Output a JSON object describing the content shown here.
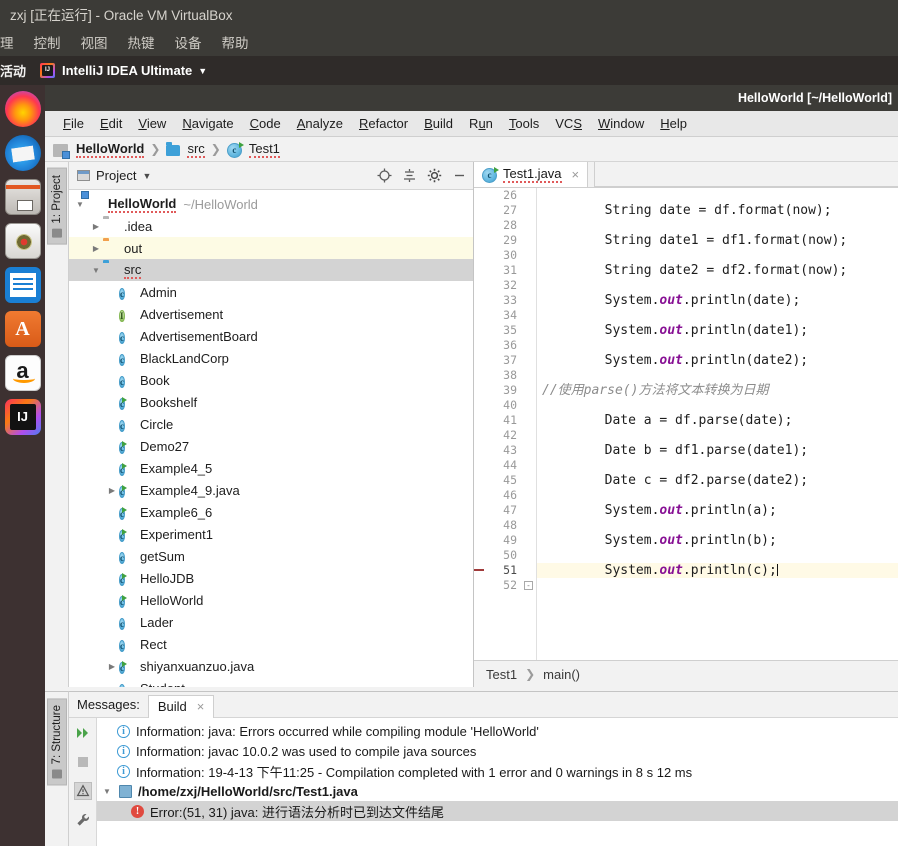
{
  "host": {
    "vbox_title": "zxj [正在运行] - Oracle VM VirtualBox",
    "vbox_menus": [
      "理",
      "控制",
      "视图",
      "热键",
      "设备",
      "帮助"
    ],
    "ubuntu_activities": "活动",
    "ubuntu_app": "IntelliJ IDEA Ultimate",
    "panel_caret": "▼"
  },
  "dock": {
    "items": [
      {
        "name": "firefox-icon",
        "label": "Firefox"
      },
      {
        "name": "thunderbird-icon",
        "label": "Thunderbird Mail"
      },
      {
        "name": "files-icon",
        "label": "Files"
      },
      {
        "name": "rhythmbox-icon",
        "label": "Rhythmbox"
      },
      {
        "name": "libreoffice-writer-icon",
        "label": "LibreOffice Writer"
      },
      {
        "name": "ubuntu-software-icon",
        "label": "Ubuntu Software"
      },
      {
        "name": "amazon-icon",
        "label": "Amazon"
      },
      {
        "name": "intellij-idea-icon",
        "label": "IntelliJ IDEA"
      }
    ]
  },
  "ide": {
    "window_title": "HelloWorld [~/HelloWorld]",
    "menus": [
      {
        "label": "File",
        "mnemonic": "F"
      },
      {
        "label": "Edit",
        "mnemonic": "E"
      },
      {
        "label": "View",
        "mnemonic": "V"
      },
      {
        "label": "Navigate",
        "mnemonic": "N"
      },
      {
        "label": "Code",
        "mnemonic": "C"
      },
      {
        "label": "Analyze",
        "mnemonic": "A"
      },
      {
        "label": "Refactor",
        "mnemonic": "R"
      },
      {
        "label": "Build",
        "mnemonic": "B"
      },
      {
        "label": "Run",
        "mnemonic": "u"
      },
      {
        "label": "Tools",
        "mnemonic": "T"
      },
      {
        "label": "VCS",
        "mnemonic": "S"
      },
      {
        "label": "Window",
        "mnemonic": "W"
      },
      {
        "label": "Help",
        "mnemonic": "H"
      }
    ],
    "navbar": [
      "HelloWorld",
      "src",
      "Test1"
    ],
    "left_tool_tab": "1: Project",
    "bottom_tool_tab": "7: Structure"
  },
  "project": {
    "title": "Project",
    "toolbar": [
      "locate-icon",
      "collapse-all-icon",
      "settings-gear-icon",
      "hide-icon"
    ],
    "tree": [
      {
        "label": "HelloWorld",
        "path": "~/HelloWorld",
        "icon": "module",
        "indent": 0,
        "arrow": "open",
        "bold": true,
        "state": "normal",
        "squiggle": true
      },
      {
        "label": ".idea",
        "path": "",
        "icon": "folder-gray",
        "indent": 1,
        "arrow": "closed",
        "bold": false,
        "state": "normal",
        "squiggle": false
      },
      {
        "label": "out",
        "path": "",
        "icon": "folder-orange",
        "indent": 1,
        "arrow": "closed",
        "bold": false,
        "state": "highlight",
        "squiggle": false
      },
      {
        "label": "src",
        "path": "",
        "icon": "folder-blue",
        "indent": 1,
        "arrow": "open",
        "bold": false,
        "state": "selected",
        "squiggle": true
      },
      {
        "label": "Admin",
        "path": "",
        "icon": "class",
        "indent": 2,
        "arrow": "none",
        "bold": false,
        "state": "normal",
        "squiggle": false
      },
      {
        "label": "Advertisement",
        "path": "",
        "icon": "interface",
        "indent": 2,
        "arrow": "none",
        "bold": false,
        "state": "normal",
        "squiggle": false
      },
      {
        "label": "AdvertisementBoard",
        "path": "",
        "icon": "class",
        "indent": 2,
        "arrow": "none",
        "bold": false,
        "state": "normal",
        "squiggle": false
      },
      {
        "label": "BlackLandCorp",
        "path": "",
        "icon": "class",
        "indent": 2,
        "arrow": "none",
        "bold": false,
        "state": "normal",
        "squiggle": false
      },
      {
        "label": "Book",
        "path": "",
        "icon": "class",
        "indent": 2,
        "arrow": "none",
        "bold": false,
        "state": "normal",
        "squiggle": false
      },
      {
        "label": "Bookshelf",
        "path": "",
        "icon": "class-run",
        "indent": 2,
        "arrow": "none",
        "bold": false,
        "state": "normal",
        "squiggle": false
      },
      {
        "label": "Circle",
        "path": "",
        "icon": "class",
        "indent": 2,
        "arrow": "none",
        "bold": false,
        "state": "normal",
        "squiggle": false
      },
      {
        "label": "Demo27",
        "path": "",
        "icon": "class-run",
        "indent": 2,
        "arrow": "none",
        "bold": false,
        "state": "normal",
        "squiggle": false
      },
      {
        "label": "Example4_5",
        "path": "",
        "icon": "class-run",
        "indent": 2,
        "arrow": "none",
        "bold": false,
        "state": "normal",
        "squiggle": false
      },
      {
        "label": "Example4_9.java",
        "path": "",
        "icon": "class-run",
        "indent": 2,
        "arrow": "closed",
        "bold": false,
        "state": "normal",
        "squiggle": false
      },
      {
        "label": "Example6_6",
        "path": "",
        "icon": "class-run",
        "indent": 2,
        "arrow": "none",
        "bold": false,
        "state": "normal",
        "squiggle": false
      },
      {
        "label": "Experiment1",
        "path": "",
        "icon": "class-run",
        "indent": 2,
        "arrow": "none",
        "bold": false,
        "state": "normal",
        "squiggle": false
      },
      {
        "label": "getSum",
        "path": "",
        "icon": "class",
        "indent": 2,
        "arrow": "none",
        "bold": false,
        "state": "normal",
        "squiggle": false
      },
      {
        "label": "HelloJDB",
        "path": "",
        "icon": "class-run",
        "indent": 2,
        "arrow": "none",
        "bold": false,
        "state": "normal",
        "squiggle": false
      },
      {
        "label": "HelloWorld",
        "path": "",
        "icon": "class-run",
        "indent": 2,
        "arrow": "none",
        "bold": false,
        "state": "normal",
        "squiggle": false
      },
      {
        "label": "Lader",
        "path": "",
        "icon": "class",
        "indent": 2,
        "arrow": "none",
        "bold": false,
        "state": "normal",
        "squiggle": false
      },
      {
        "label": "Rect",
        "path": "",
        "icon": "class",
        "indent": 2,
        "arrow": "none",
        "bold": false,
        "state": "normal",
        "squiggle": false
      },
      {
        "label": "shiyanxuanzuo.java",
        "path": "",
        "icon": "class-run",
        "indent": 2,
        "arrow": "closed",
        "bold": false,
        "state": "normal",
        "squiggle": false
      },
      {
        "label": "Student",
        "path": "",
        "icon": "class",
        "indent": 2,
        "arrow": "none",
        "bold": false,
        "state": "normal",
        "squiggle": false
      }
    ]
  },
  "editor": {
    "tab": {
      "label": "Test1.java",
      "icon": "java-class-icon",
      "close": "×"
    },
    "breadcrumb": [
      "Test1",
      "main()"
    ],
    "first_line_number": 26,
    "current_line": 51,
    "error_line": 51,
    "lines": [
      {
        "n": 26,
        "text": ""
      },
      {
        "n": 27,
        "text": "        String date = df.format(now);"
      },
      {
        "n": 28,
        "text": ""
      },
      {
        "n": 29,
        "text": "        String date1 = df1.format(now);"
      },
      {
        "n": 30,
        "text": ""
      },
      {
        "n": 31,
        "text": "        String date2 = df2.format(now);"
      },
      {
        "n": 32,
        "text": ""
      },
      {
        "n": 33,
        "text": "        System.out.println(date);",
        "field": "out"
      },
      {
        "n": 34,
        "text": ""
      },
      {
        "n": 35,
        "text": "        System.out.println(date1);",
        "field": "out"
      },
      {
        "n": 36,
        "text": ""
      },
      {
        "n": 37,
        "text": "        System.out.println(date2);",
        "field": "out"
      },
      {
        "n": 38,
        "text": ""
      },
      {
        "n": 39,
        "text": "//使用parse()方法将文本转换为日期",
        "comment": true
      },
      {
        "n": 40,
        "text": ""
      },
      {
        "n": 41,
        "text": "        Date a = df.parse(date);"
      },
      {
        "n": 42,
        "text": ""
      },
      {
        "n": 43,
        "text": "        Date b = df1.parse(date1);"
      },
      {
        "n": 44,
        "text": ""
      },
      {
        "n": 45,
        "text": "        Date c = df2.parse(date2);"
      },
      {
        "n": 46,
        "text": ""
      },
      {
        "n": 47,
        "text": "        System.out.println(a);",
        "field": "out"
      },
      {
        "n": 48,
        "text": ""
      },
      {
        "n": 49,
        "text": "        System.out.println(b);",
        "field": "out"
      },
      {
        "n": 50,
        "text": ""
      },
      {
        "n": 51,
        "text": "        System.out.println(c);",
        "field": "out",
        "caret": true
      },
      {
        "n": 52,
        "text": ""
      }
    ]
  },
  "messages": {
    "label": "Messages:",
    "tab": "Build",
    "tab_close": "×",
    "tools": [
      "rerun-icon",
      "stop-icon",
      "warnings-filter-icon",
      "settings-wrench-icon"
    ],
    "rows": [
      {
        "icon": "info-icon",
        "text": "Information: java: Errors occurred while compiling module 'HelloWorld'",
        "indent": 1,
        "bold": false,
        "selected": false,
        "arrow": "none"
      },
      {
        "icon": "info-icon",
        "text": "Information: javac 10.0.2 was used to compile java sources",
        "indent": 1,
        "bold": false,
        "selected": false,
        "arrow": "none"
      },
      {
        "icon": "info-icon",
        "text": "Information: 19-4-13 下午11:25 - Compilation completed with 1 error and 0 warnings in 8 s 12 ms",
        "indent": 1,
        "bold": false,
        "selected": false,
        "arrow": "none"
      },
      {
        "icon": "file-icon",
        "text": "/home/zxj/HelloWorld/src/Test1.java",
        "indent": 0,
        "bold": true,
        "selected": false,
        "arrow": "open"
      },
      {
        "icon": "error-icon",
        "text": "Error:(51, 31)  java: 进行语法分析时已到达文件结尾",
        "indent": 2,
        "bold": false,
        "selected": true,
        "arrow": "none"
      }
    ]
  },
  "colors": {
    "accent_blue": "#3d9ad4",
    "error_red": "#e04a3f",
    "selection_gray": "#d3d3d3",
    "highlight_yellow": "#fdfbe4",
    "current_line": "#fffae6",
    "chrome_dark": "#3c3b37"
  }
}
